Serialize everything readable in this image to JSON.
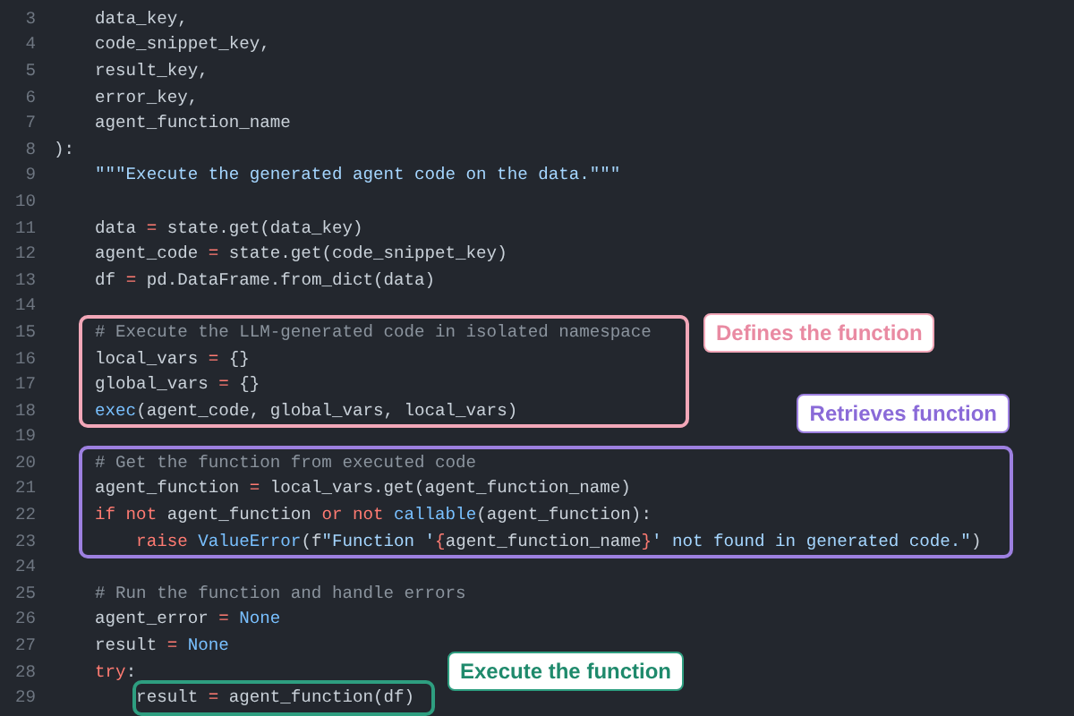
{
  "code_lines": [
    {
      "number": "3",
      "tokens": [
        {
          "kind": "plain",
          "text": "    data_key,"
        }
      ]
    },
    {
      "number": "4",
      "tokens": [
        {
          "kind": "plain",
          "text": "    code_snippet_key,"
        }
      ]
    },
    {
      "number": "5",
      "tokens": [
        {
          "kind": "plain",
          "text": "    result_key,"
        }
      ]
    },
    {
      "number": "6",
      "tokens": [
        {
          "kind": "plain",
          "text": "    error_key,"
        }
      ]
    },
    {
      "number": "7",
      "tokens": [
        {
          "kind": "plain",
          "text": "    agent_function_name"
        }
      ]
    },
    {
      "number": "8",
      "tokens": [
        {
          "kind": "plain",
          "text": "):"
        }
      ]
    },
    {
      "number": "9",
      "tokens": [
        {
          "kind": "string",
          "text": "    \"\"\"Execute the generated agent code on the data.\"\"\""
        }
      ]
    },
    {
      "number": "10"
    },
    {
      "number": "11",
      "tokens": [
        {
          "kind": "plain",
          "text": "    data "
        },
        {
          "kind": "keyword",
          "text": "="
        },
        {
          "kind": "plain",
          "text": " state.get(data_key)"
        }
      ]
    },
    {
      "number": "12",
      "tokens": [
        {
          "kind": "plain",
          "text": "    agent_code "
        },
        {
          "kind": "keyword",
          "text": "="
        },
        {
          "kind": "plain",
          "text": " state.get(code_snippet_key)"
        }
      ]
    },
    {
      "number": "13",
      "tokens": [
        {
          "kind": "plain",
          "text": "    df "
        },
        {
          "kind": "keyword",
          "text": "="
        },
        {
          "kind": "plain",
          "text": " pd.DataFrame.from_dict(data)"
        }
      ]
    },
    {
      "number": "14"
    },
    {
      "number": "15",
      "tokens": [
        {
          "kind": "comment",
          "text": "    # Execute the LLM-generated code in isolated namespace"
        }
      ]
    },
    {
      "number": "16",
      "tokens": [
        {
          "kind": "plain",
          "text": "    local_vars "
        },
        {
          "kind": "keyword",
          "text": "="
        },
        {
          "kind": "plain",
          "text": " {}"
        }
      ]
    },
    {
      "number": "17",
      "tokens": [
        {
          "kind": "plain",
          "text": "    global_vars "
        },
        {
          "kind": "keyword",
          "text": "="
        },
        {
          "kind": "plain",
          "text": " {}"
        }
      ]
    },
    {
      "number": "18",
      "tokens": [
        {
          "kind": "builtin",
          "text": "    exec"
        },
        {
          "kind": "plain",
          "text": "(agent_code, global_vars, local_vars)"
        }
      ]
    },
    {
      "number": "19"
    },
    {
      "number": "20",
      "tokens": [
        {
          "kind": "comment",
          "text": "    # Get the function from executed code"
        }
      ]
    },
    {
      "number": "21",
      "tokens": [
        {
          "kind": "plain",
          "text": "    agent_function "
        },
        {
          "kind": "keyword",
          "text": "="
        },
        {
          "kind": "plain",
          "text": " local_vars.get(agent_function_name)"
        }
      ]
    },
    {
      "number": "22",
      "tokens": [
        {
          "kind": "keyword",
          "text": "    if not"
        },
        {
          "kind": "plain",
          "text": " agent_function "
        },
        {
          "kind": "keyword",
          "text": "or not "
        },
        {
          "kind": "builtin",
          "text": "callable"
        },
        {
          "kind": "plain",
          "text": "(agent_function):"
        }
      ]
    },
    {
      "number": "23",
      "tokens": [
        {
          "kind": "keyword",
          "text": "        raise "
        },
        {
          "kind": "builtin",
          "text": "ValueError"
        },
        {
          "kind": "plain",
          "text": "(f"
        },
        {
          "kind": "string",
          "text": "\"Function '"
        },
        {
          "kind": "keyword",
          "text": "{"
        },
        {
          "kind": "plain",
          "text": "agent_function_name"
        },
        {
          "kind": "keyword",
          "text": "}"
        },
        {
          "kind": "string",
          "text": "' not found in generated code.\""
        },
        {
          "kind": "plain",
          "text": ")"
        }
      ]
    },
    {
      "number": "24"
    },
    {
      "number": "25",
      "tokens": [
        {
          "kind": "comment",
          "text": "    # Run the function and handle errors"
        }
      ]
    },
    {
      "number": "26",
      "tokens": [
        {
          "kind": "plain",
          "text": "    agent_error "
        },
        {
          "kind": "keyword",
          "text": "="
        },
        {
          "kind": "builtin",
          "text": " None"
        }
      ]
    },
    {
      "number": "27",
      "tokens": [
        {
          "kind": "plain",
          "text": "    result "
        },
        {
          "kind": "keyword",
          "text": "="
        },
        {
          "kind": "builtin",
          "text": " None"
        }
      ]
    },
    {
      "number": "28",
      "tokens": [
        {
          "kind": "keyword",
          "text": "    try"
        },
        {
          "kind": "plain",
          "text": ":"
        }
      ]
    },
    {
      "number": "29",
      "tokens": [
        {
          "kind": "plain",
          "text": "        result "
        },
        {
          "kind": "keyword",
          "text": "="
        },
        {
          "kind": "plain",
          "text": " agent_function(df)"
        }
      ]
    }
  ],
  "annotations": [
    {
      "label": "Defines the function",
      "color": "#f2a7b8"
    },
    {
      "label": "Retrieves function",
      "color": "#9d80e0"
    },
    {
      "label": "Execute the function",
      "color": "#2e9e80"
    }
  ]
}
